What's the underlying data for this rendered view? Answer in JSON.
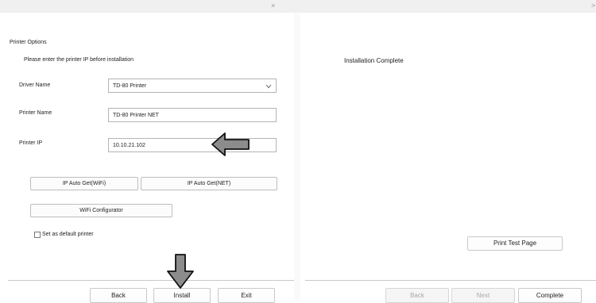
{
  "left": {
    "section_title": "Printer Options",
    "instruction": "Please enter the printer IP before installation",
    "driver_name_label": "Driver Name",
    "driver_name_value": "TD-80 Printer",
    "printer_name_label": "Printer Name",
    "printer_name_value": "TD-80 Printer NET",
    "printer_ip_label": "Printer IP",
    "printer_ip_value": "10.10.21.102",
    "ip_auto_wifi_label": "IP Auto Get(WiFi)",
    "ip_auto_net_label": "IP Auto Get(NET)",
    "wifi_configurator_label": "WiFi Configurator",
    "default_printer_label": "Set as default printer",
    "default_printer_checked": false,
    "back_label": "Back",
    "install_label": "Install",
    "exit_label": "Exit",
    "close_glyph": "×"
  },
  "right": {
    "status_text": "Installation Complete",
    "print_test_label": "Print Test Page",
    "back_label": "Back",
    "next_label": "Next",
    "complete_label": "Complete",
    "close_glyph": ">"
  },
  "annotations": {
    "arrow_color": "#8c8c8c",
    "arrow_outline": "#111111"
  }
}
